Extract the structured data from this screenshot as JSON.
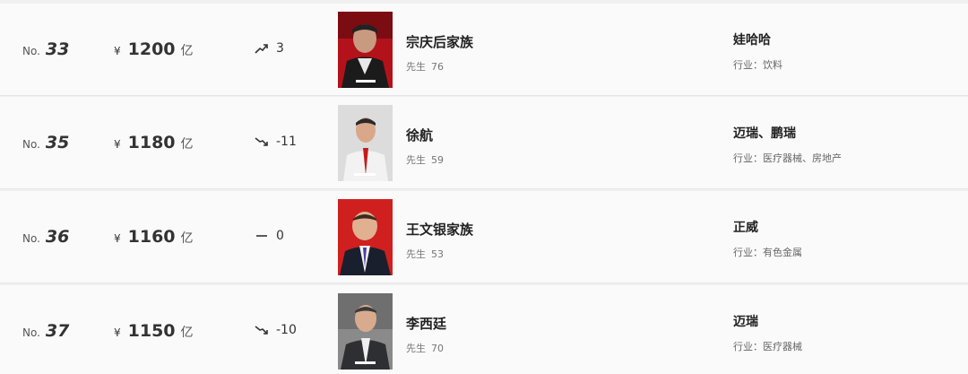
{
  "rows": [
    {
      "rank_prefix": "No.",
      "rank": "33",
      "currency": "¥",
      "wealth": "1200",
      "unit": "亿",
      "trend": "up",
      "change": "3",
      "name": "宗庆后家族",
      "title": "先生",
      "age": "76",
      "company": "娃哈哈",
      "industry": "行业：饮料",
      "photo_bg": "#b3121a"
    },
    {
      "rank_prefix": "No.",
      "rank": "35",
      "currency": "¥",
      "wealth": "1180",
      "unit": "亿",
      "trend": "down",
      "change": "-11",
      "name": "徐航",
      "title": "先生",
      "age": "59",
      "company": "迈瑞、鹏瑞",
      "industry": "行业：医疗器械、房地产",
      "photo_bg": "#d9d9d9"
    },
    {
      "rank_prefix": "No.",
      "rank": "36",
      "currency": "¥",
      "wealth": "1160",
      "unit": "亿",
      "trend": "flat",
      "change": "0",
      "name": "王文银家族",
      "title": "先生",
      "age": "53",
      "company": "正威",
      "industry": "行业：有色金属",
      "photo_bg": "#d01f1f"
    },
    {
      "rank_prefix": "No.",
      "rank": "37",
      "currency": "¥",
      "wealth": "1150",
      "unit": "亿",
      "trend": "down",
      "change": "-10",
      "name": "李西廷",
      "title": "先生",
      "age": "70",
      "company": "迈瑞",
      "industry": "行业：医疗器械",
      "photo_bg": "#8a8a8a"
    }
  ]
}
